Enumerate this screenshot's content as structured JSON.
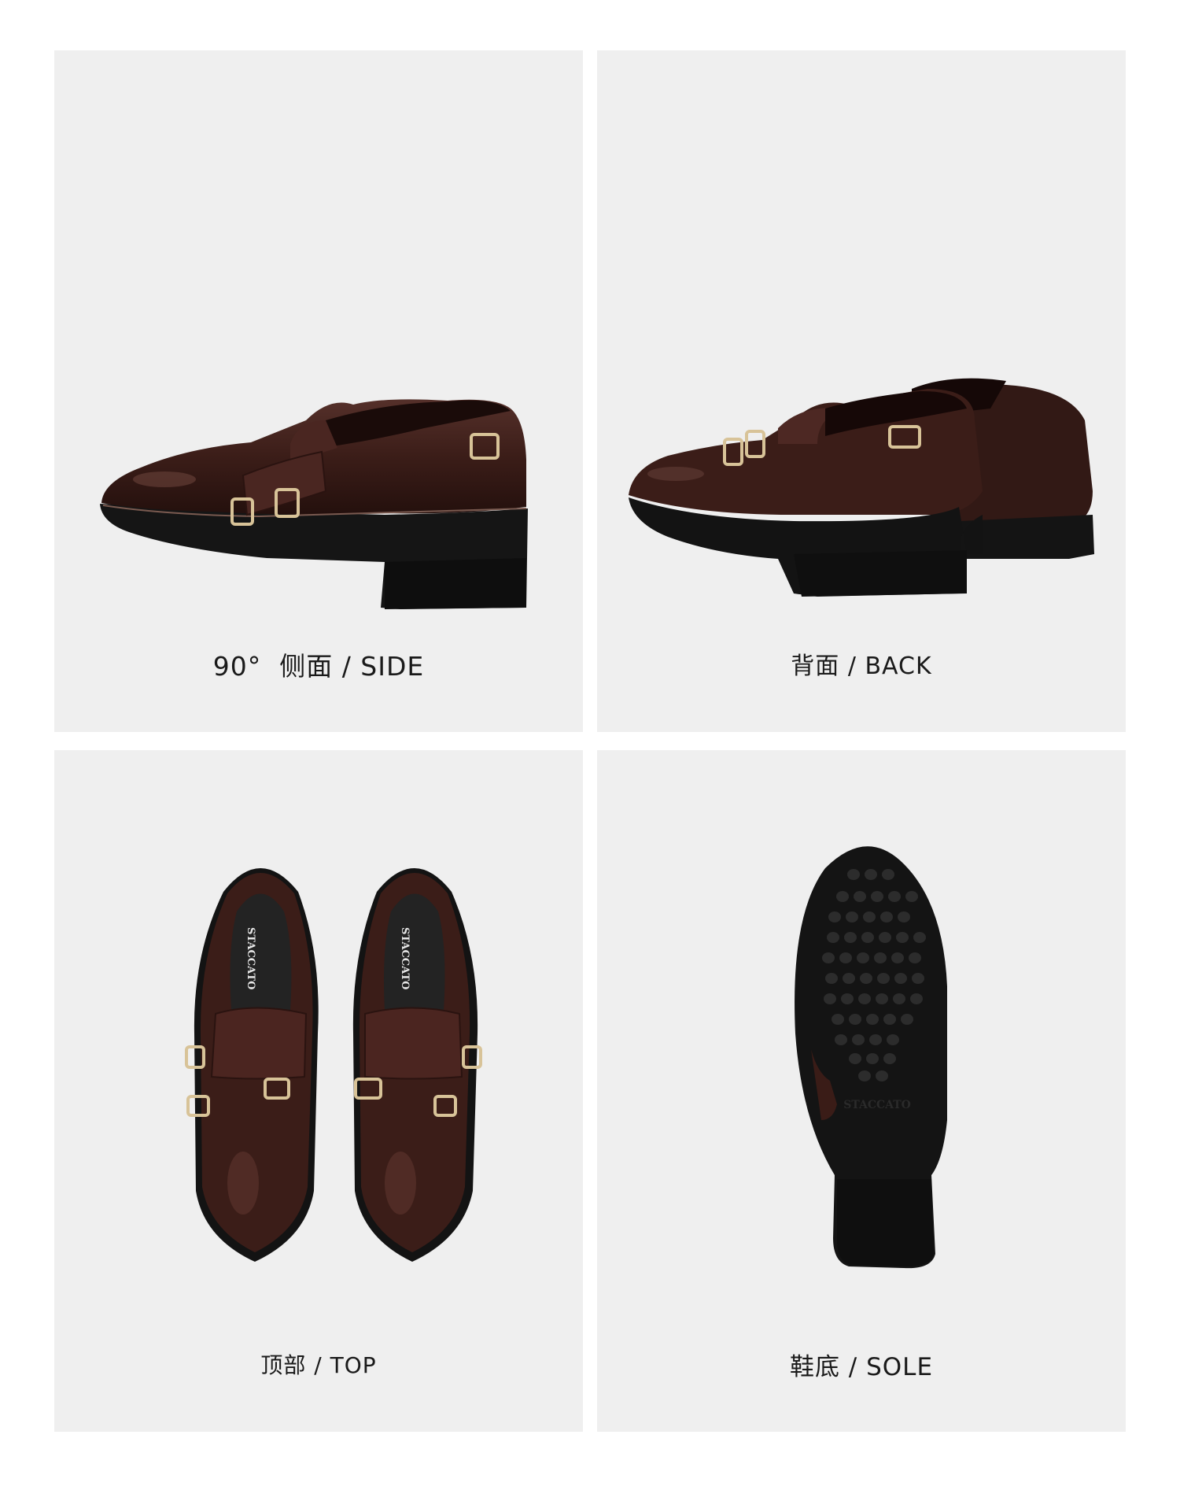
{
  "panels": [
    {
      "caption": "90°  侧面 / SIDE",
      "view": "side"
    },
    {
      "caption": "背面 / BACK",
      "view": "back"
    },
    {
      "caption": "顶部 / TOP",
      "view": "top"
    },
    {
      "caption": "鞋底 / SOLE",
      "view": "sole"
    }
  ],
  "brand_marks": {
    "insole_left": "STACCATO",
    "insole_right": "STACCATO",
    "sole": "STACCATO"
  },
  "colors": {
    "panel_bg": "#efefef",
    "leather": "#3d1e19",
    "sole": "#121212",
    "buckle": "#d8c398"
  }
}
